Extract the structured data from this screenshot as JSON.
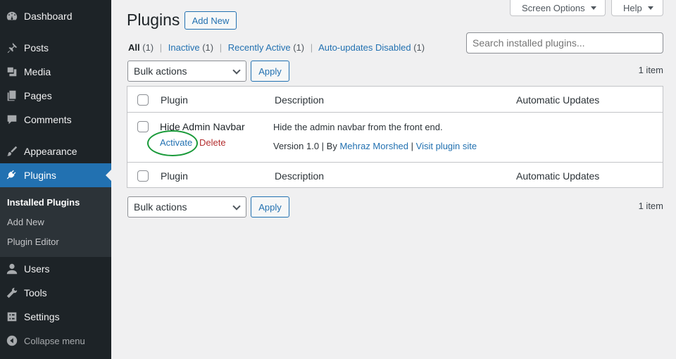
{
  "sidebar": {
    "items": [
      {
        "label": "Dashboard",
        "icon": "dashboard-icon"
      },
      {
        "label": "Posts",
        "icon": "pin-icon"
      },
      {
        "label": "Media",
        "icon": "media-icon"
      },
      {
        "label": "Pages",
        "icon": "pages-icon"
      },
      {
        "label": "Comments",
        "icon": "comment-icon"
      },
      {
        "label": "Appearance",
        "icon": "brush-icon"
      },
      {
        "label": "Plugins",
        "icon": "plugin-icon"
      },
      {
        "label": "Users",
        "icon": "user-icon"
      },
      {
        "label": "Tools",
        "icon": "wrench-icon"
      },
      {
        "label": "Settings",
        "icon": "settings-icon"
      },
      {
        "label": "Collapse menu",
        "icon": "collapse-icon"
      }
    ],
    "submenu": [
      "Installed Plugins",
      "Add New",
      "Plugin Editor"
    ],
    "active_color": "#2271b1"
  },
  "top": {
    "screen_options": "Screen Options",
    "help": "Help"
  },
  "header": {
    "title": "Plugins",
    "add_new": "Add New"
  },
  "filters": {
    "all": "All",
    "all_count": "(1)",
    "inactive": "Inactive",
    "inactive_count": "(1)",
    "recent": "Recently Active",
    "recent_count": "(1)",
    "auto": "Auto-updates Disabled",
    "auto_count": "(1)"
  },
  "search": {
    "placeholder": "Search installed plugins..."
  },
  "bulk": {
    "label": "Bulk actions",
    "apply": "Apply",
    "count": "1 item"
  },
  "table": {
    "col_plugin": "Plugin",
    "col_description": "Description",
    "col_updates": "Automatic Updates",
    "row": {
      "name": "Hide Admin Navbar",
      "activate": "Activate",
      "delete": "Delete",
      "description": "Hide the admin navbar from the front end.",
      "version": "Version 1.0",
      "by": "By",
      "author": "Mehraz Morshed",
      "visit": "Visit plugin site"
    }
  }
}
